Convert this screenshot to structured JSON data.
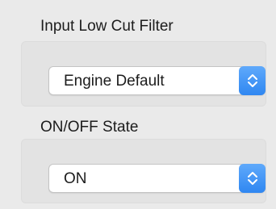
{
  "input_low_cut_filter": {
    "label": "Input Low Cut Filter",
    "selected": "Engine Default",
    "icon": "chevron-up-down-icon"
  },
  "on_off_state": {
    "label": "ON/OFF State",
    "selected": "ON",
    "icon": "chevron-up-down-icon"
  },
  "colors": {
    "accent": "#3b8ff4",
    "panel": "#eaeaea",
    "group": "#e3e3e3"
  }
}
